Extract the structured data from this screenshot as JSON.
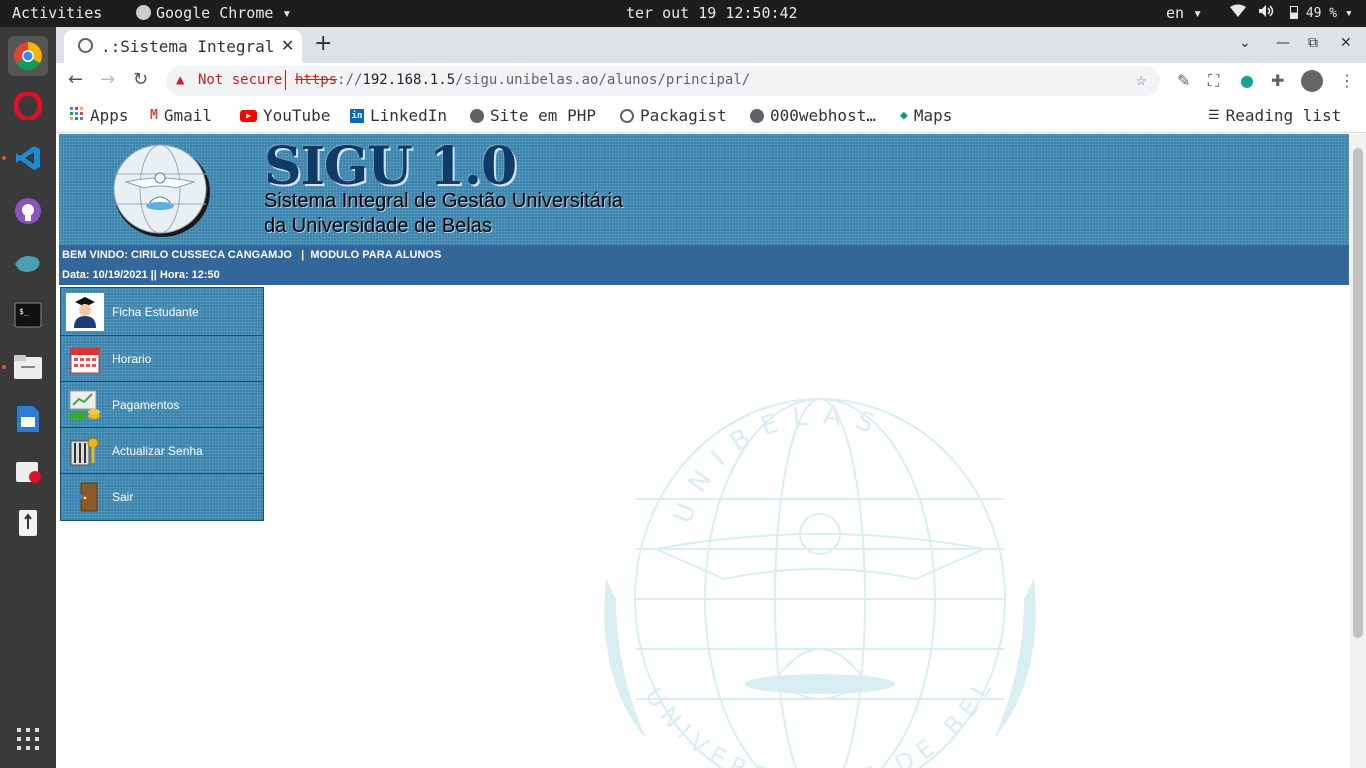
{
  "os": {
    "activities": "Activities",
    "app_menu": "Google Chrome",
    "datetime": "ter out 19 12:50:42",
    "language": "en",
    "battery": "49 %"
  },
  "browser": {
    "tab_title": ".:Sistema Integral de Gestão Universitária",
    "omnibox": {
      "security_label": "Not secure",
      "url_scheme": "https",
      "url_host": "192.168.1.5",
      "url_path": "/sigu.unibelas.ao/alunos/principal/"
    },
    "bookmarks": [
      {
        "label": "Apps",
        "icon": "apps-grid-icon"
      },
      {
        "label": "Gmail",
        "icon": "gmail-icon"
      },
      {
        "label": "YouTube",
        "icon": "youtube-icon"
      },
      {
        "label": "LinkedIn",
        "icon": "linkedin-icon"
      },
      {
        "label": "Site em PHP",
        "icon": "globe-icon"
      },
      {
        "label": "Packagist",
        "icon": "packagist-icon"
      },
      {
        "label": "000webhost…",
        "icon": "globe-icon"
      },
      {
        "label": "Maps",
        "icon": "maps-icon"
      }
    ],
    "reading_list": "Reading list"
  },
  "header": {
    "title": "SIGU 1.0",
    "subtitle_line1": "Sistema Integral de Gestão Universitária",
    "subtitle_line2": "da Universidade de Belas"
  },
  "infobar": {
    "welcome": "BEM VINDO: CIRILO CUSSECA CANGAMJO   |  MODULO PARA ALUNOS",
    "datetime": "Data: 10/19/2021 || Hora: 12:50"
  },
  "menu": [
    {
      "label": "Ficha Estudante",
      "icon": "student-icon"
    },
    {
      "label": "Horario",
      "icon": "calendar-icon"
    },
    {
      "label": "Pagamentos",
      "icon": "payments-icon"
    },
    {
      "label": "Actualizar Senha",
      "icon": "keys-icon"
    },
    {
      "label": "Sair",
      "icon": "exit-door-icon"
    }
  ],
  "watermark": {
    "top_text": "UNIBELAS",
    "bottom_text": "UNIVERSIDADE DE BELAS"
  },
  "colors": {
    "banner_blue": "#3b84ad",
    "infobar_blue": "#336699",
    "watermark": "#d8eef2"
  }
}
